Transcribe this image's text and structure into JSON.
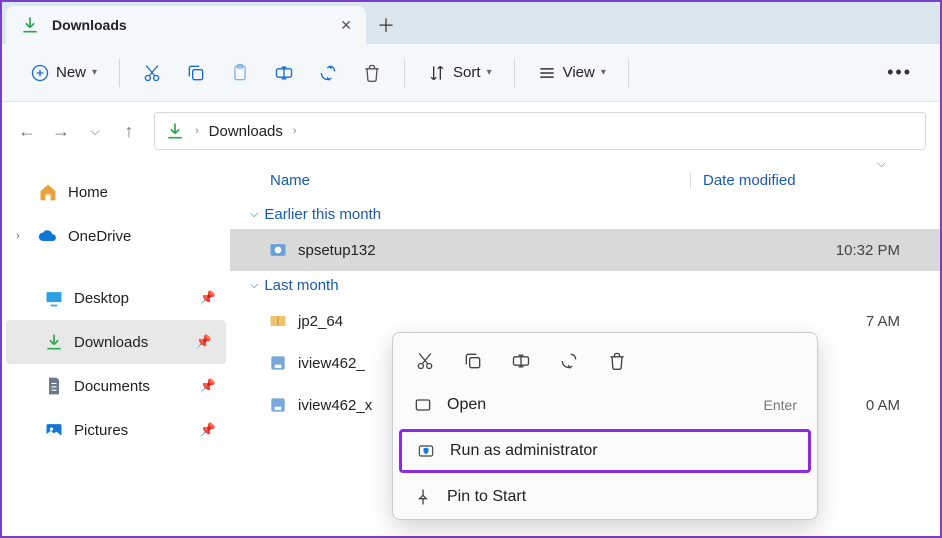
{
  "tab": {
    "title": "Downloads"
  },
  "toolbar": {
    "new": "New",
    "sort": "Sort",
    "view": "View"
  },
  "breadcrumb": {
    "current": "Downloads"
  },
  "sidebar": {
    "home": "Home",
    "onedrive": "OneDrive",
    "items": [
      {
        "label": "Desktop"
      },
      {
        "label": "Downloads"
      },
      {
        "label": "Documents"
      },
      {
        "label": "Pictures"
      }
    ]
  },
  "columns": {
    "name": "Name",
    "date": "Date modified"
  },
  "groups": [
    {
      "label": "Earlier this month",
      "files": [
        {
          "name": "spsetup132",
          "date": "10:32 PM"
        }
      ]
    },
    {
      "label": "Last month",
      "files": [
        {
          "name": "jp2_64",
          "date": "7 AM"
        },
        {
          "name": "iview462_",
          "date": ""
        },
        {
          "name": "iview462_x",
          "date": "0 AM"
        }
      ]
    }
  ],
  "contextmenu": {
    "open": "Open",
    "open_shortcut": "Enter",
    "runas": "Run as administrator",
    "pin": "Pin to Start"
  }
}
